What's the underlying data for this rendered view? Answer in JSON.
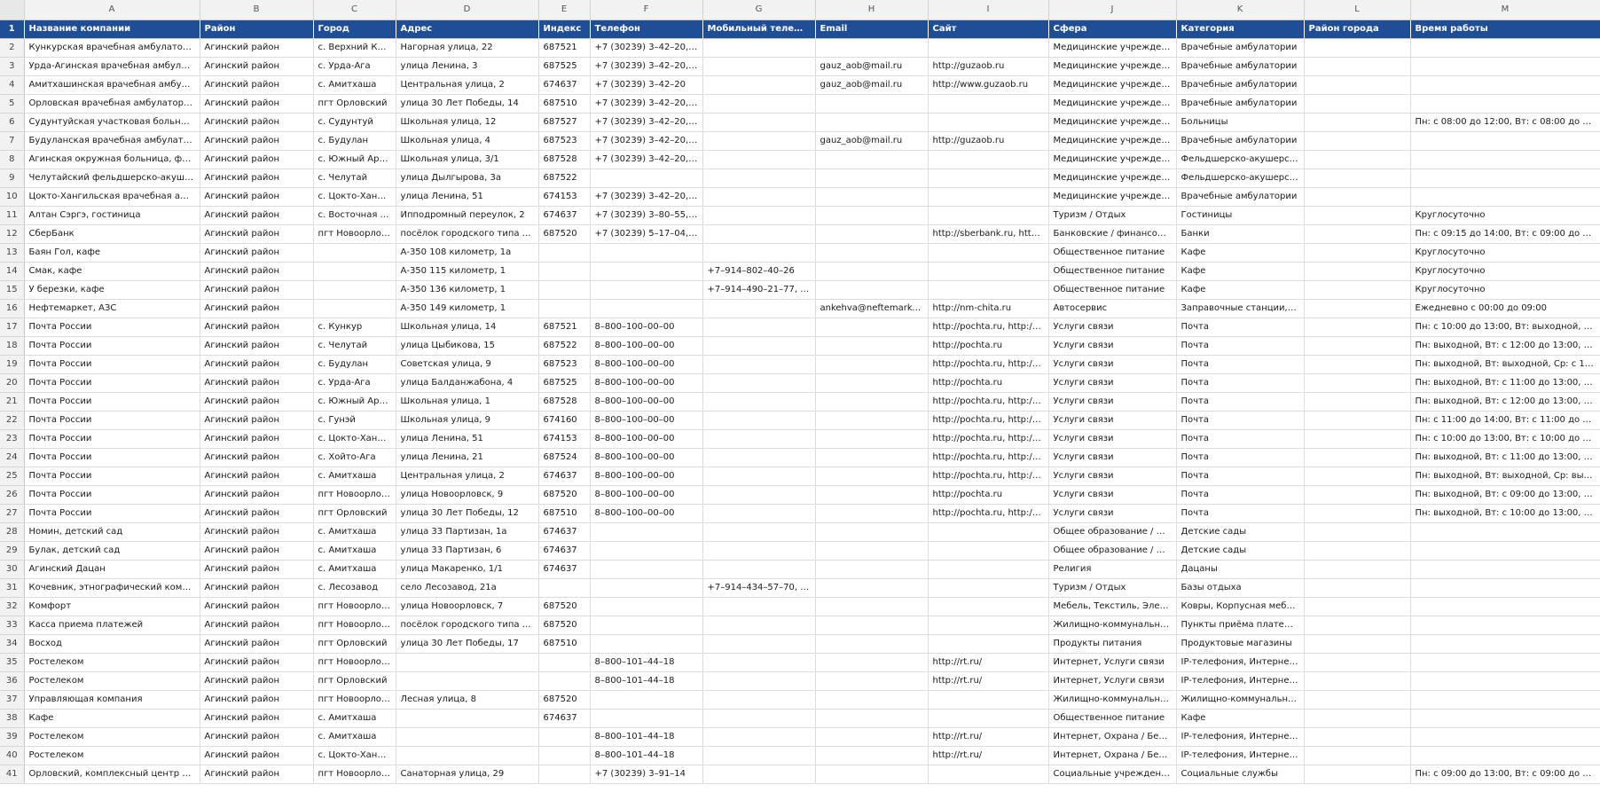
{
  "columns": [
    "A",
    "B",
    "C",
    "D",
    "E",
    "F",
    "G",
    "H",
    "I",
    "J",
    "K",
    "L",
    "M"
  ],
  "headers": [
    "Название компании",
    "Район",
    "Город",
    "Адрес",
    "Индекс",
    "Телефон",
    "Мобильный телефон",
    "Email",
    "Сайт",
    "Сфера",
    "Категория",
    "Район города",
    "Время работы"
  ],
  "header_row_number": "1",
  "rows": [
    {
      "n": "2",
      "c": [
        "Кункурская врачебная амбулатория",
        "Агинский район",
        "с. Верхний Кунк…",
        "Нагорная улица, 22",
        "687521",
        "+7 (30239) 3–42–20, +7…",
        "",
        "",
        "",
        "Медицинские учреждения",
        "Врачебные амбулатории",
        "",
        ""
      ]
    },
    {
      "n": "3",
      "c": [
        "Урда-Агинская врачебная амбулатория",
        "Агинский район",
        "с. Урда-Ага",
        "улица Ленина, 3",
        "687525",
        "+7 (30239) 3–42–20, +7…",
        "",
        "gauz_aob@mail.ru",
        "http://guzaob.ru",
        "Медицинские учреждения",
        "Врачебные амбулатории",
        "",
        ""
      ]
    },
    {
      "n": "4",
      "c": [
        "Амитхашинская врачебная амбулато…",
        "Агинский район",
        "с. Амитхаша",
        "Центральная улица, 2",
        "674637",
        "+7 (30239) 3–42–20",
        "",
        "gauz_aob@mail.ru",
        "http://www.guzaob.ru",
        "Медицинские учреждения",
        "Врачебные амбулатории",
        "",
        ""
      ]
    },
    {
      "n": "5",
      "c": [
        "Орловская врачебная амбулатория",
        "Агинский район",
        "пгт Орловский",
        "улица 30 Лет Победы, 14",
        "687510",
        "+7 (30239) 3–42–20, +7…",
        "",
        "",
        "",
        "Медицинские учреждения",
        "Врачебные амбулатории",
        "",
        ""
      ]
    },
    {
      "n": "6",
      "c": [
        "Судунтуйская участковая больница",
        "Агинский район",
        "с. Судунтуй",
        "Школьная улица, 12",
        "687527",
        "+7 (30239) 3–42–20, +7…",
        "",
        "",
        "",
        "Медицинские учреждения",
        "Больницы",
        "",
        "Пн: с 08:00 до 12:00, Вт: с 08:00 до 12:00, С…"
      ]
    },
    {
      "n": "7",
      "c": [
        "Будуланская врачебная амбулатория",
        "Агинский район",
        "с. Будулан",
        "Школьная улица, 4",
        "687523",
        "+7 (30239) 3–42–20, +7…",
        "",
        "gauz_aob@mail.ru",
        "http://guzaob.ru",
        "Медицинские учреждения",
        "Врачебные амбулатории",
        "",
        ""
      ]
    },
    {
      "n": "8",
      "c": [
        "Агинская окружная больница, фельд…",
        "Агинский район",
        "с. Южный Арга…",
        "Школьная улица, 3/1",
        "687528",
        "+7 (30239) 3–42–20, +7…",
        "",
        "",
        "",
        "Медицинские учреждения",
        "Фельдшерско-акушерские…",
        "",
        ""
      ]
    },
    {
      "n": "9",
      "c": [
        "Челутайский фельдшерско-акушерск…",
        "Агинский район",
        "с. Челутай",
        "улица Дылгырова, 3а",
        "687522",
        "",
        "",
        "",
        "",
        "Медицинские учреждения",
        "Фельдшерско-акушерские…",
        "",
        ""
      ]
    },
    {
      "n": "10",
      "c": [
        "Цокто-Хангильская врачебная амбул…",
        "Агинский район",
        "с. Цокто-Хангил",
        "улица Ленина, 51",
        "674153",
        "+7 (30239) 3–42–20, +7…",
        "",
        "",
        "",
        "Медицинские учреждения",
        "Врачебные амбулатории",
        "",
        ""
      ]
    },
    {
      "n": "11",
      "c": [
        "Алтан Сэргэ, гостиница",
        "Агинский район",
        "с. Восточная А…",
        "Ипподромный переулок, 2",
        "674637",
        "+7 (30239) 3–80–55, +7…",
        "",
        "",
        "",
        "Туризм / Отдых",
        "Гостиницы",
        "",
        "Круглосуточно"
      ]
    },
    {
      "n": "12",
      "c": [
        "СберБанк",
        "Агинский район",
        "пгт Новоорловск",
        "посёлок городского типа Нов…",
        "687520",
        "+7 (30239) 5–17–04, +7…",
        "",
        "",
        "http://sberbank.ru, http://…",
        "Банковские / финансовые…",
        "Банки",
        "",
        "Пн: с 09:15 до 14:00, Вт: с 09:00 до 14:00, С…"
      ]
    },
    {
      "n": "13",
      "c": [
        "Баян Гол, кафе",
        "Агинский район",
        "",
        "А-350 108 километр, 1а",
        "",
        "",
        "",
        "",
        "",
        "Общественное питание",
        "Кафе",
        "",
        "Круглосуточно"
      ]
    },
    {
      "n": "14",
      "c": [
        "Смак, кафе",
        "Агинский район",
        "",
        "А-350 115 километр, 1",
        "",
        "",
        "+7–914–802–40–26",
        "",
        "",
        "Общественное питание",
        "Кафе",
        "",
        "Круглосуточно"
      ]
    },
    {
      "n": "15",
      "c": [
        "У березки, кафе",
        "Агинский район",
        "",
        "А-350 136 километр, 1",
        "",
        "",
        "+7–914–490–21–77, +7…",
        "",
        "",
        "Общественное питание",
        "Кафе",
        "",
        "Круглосуточно"
      ]
    },
    {
      "n": "16",
      "c": [
        "Нефтемаркет, АЗС",
        "Агинский район",
        "",
        "А-350 149 километр, 1",
        "",
        "",
        "",
        "ankehva@neftemarket.c…",
        "http://nm-chita.ru",
        "Автосервис",
        "Заправочные станции, Он…",
        "",
        "Ежедневно с 00:00 до 09:00"
      ]
    },
    {
      "n": "17",
      "c": [
        "Почта России",
        "Агинский район",
        "с. Кункур",
        "Школьная улица, 14",
        "687521",
        "8–800–100–00–00",
        "",
        "",
        "http://pochta.ru, http://po…",
        "Услуги связи",
        "Почта",
        "",
        "Пн: с 10:00 до 13:00, Вт: выходной, Ср: с 1…"
      ]
    },
    {
      "n": "18",
      "c": [
        "Почта России",
        "Агинский район",
        "с. Челутай",
        "улица Цыбикова, 15",
        "687522",
        "8–800–100–00–00",
        "",
        "",
        "http://pochta.ru",
        "Услуги связи",
        "Почта",
        "",
        "Пн: выходной, Вт: с 12:00 до 13:00, Ср: вы…"
      ]
    },
    {
      "n": "19",
      "c": [
        "Почта России",
        "Агинский район",
        "с. Будулан",
        "Советская улица, 9",
        "687523",
        "8–800–100–00–00",
        "",
        "",
        "http://pochta.ru, http://po…",
        "Услуги связи",
        "Почта",
        "",
        "Пн: выходной, Вт: выходной, Ср: с 10:00 д…"
      ]
    },
    {
      "n": "20",
      "c": [
        "Почта России",
        "Агинский район",
        "с. Урда-Ага",
        "улица Балданжабона, 4",
        "687525",
        "8–800–100–00–00",
        "",
        "",
        "http://pochta.ru",
        "Услуги связи",
        "Почта",
        "",
        "Пн: выходной, Вт: с 11:00 до 13:00, Ср: вы…"
      ]
    },
    {
      "n": "21",
      "c": [
        "Почта России",
        "Агинский район",
        "с. Южный Арга…",
        "Школьная улица, 1",
        "687528",
        "8–800–100–00–00",
        "",
        "",
        "http://pochta.ru, http://po…",
        "Услуги связи",
        "Почта",
        "",
        "Пн: выходной, Вт: с 12:00 до 13:00, Ср: вы…"
      ]
    },
    {
      "n": "22",
      "c": [
        "Почта России",
        "Агинский район",
        "с. Гунэй",
        "Школьная улица, 9",
        "674160",
        "8–800–100–00–00",
        "",
        "",
        "http://pochta.ru, http://po…",
        "Услуги связи",
        "Почта",
        "",
        "Пн: с 11:00 до 14:00, Вт: с 11:00 до 14:00, С…"
      ]
    },
    {
      "n": "23",
      "c": [
        "Почта России",
        "Агинский район",
        "с. Цокто-Хангил",
        "улица Ленина, 51",
        "674153",
        "8–800–100–00–00",
        "",
        "",
        "http://pochta.ru, http://po…",
        "Услуги связи",
        "Почта",
        "",
        "Пн: с 10:00 до 13:00, Вт: с 10:00 до 13:00, С…"
      ]
    },
    {
      "n": "24",
      "c": [
        "Почта России",
        "Агинский район",
        "с. Хойто-Ага",
        "улица Ленина, 21",
        "687524",
        "8–800–100–00–00",
        "",
        "",
        "http://pochta.ru, http://po…",
        "Услуги связи",
        "Почта",
        "",
        "Пн: выходной, Вт: с 11:00 до 13:00, Ср: вы…"
      ]
    },
    {
      "n": "25",
      "c": [
        "Почта России",
        "Агинский район",
        "с. Амитхаша",
        "Центральная улица, 2",
        "674637",
        "8–800–100–00–00",
        "",
        "",
        "http://pochta.ru, http://po…",
        "Услуги связи",
        "Почта",
        "",
        "Пн: выходной, Вт: выходной, Ср: выходно…"
      ]
    },
    {
      "n": "26",
      "c": [
        "Почта России",
        "Агинский район",
        "пгт Новоорловск",
        "улица Новоорловск, 9",
        "687520",
        "8–800–100–00–00",
        "",
        "",
        "http://pochta.ru",
        "Услуги связи",
        "Почта",
        "",
        "Пн: выходной, Вт: с 09:00 до 13:00, Ср: с 0…"
      ]
    },
    {
      "n": "27",
      "c": [
        "Почта России",
        "Агинский район",
        "пгт Орловский",
        "улица 30 Лет Победы, 12",
        "687510",
        "8–800–100–00–00",
        "",
        "",
        "http://pochta.ru, http://po…",
        "Услуги связи",
        "Почта",
        "",
        "Пн: выходной, Вт: с 10:00 до 13:00, Ср: с 1…"
      ]
    },
    {
      "n": "28",
      "c": [
        "Номин, детский сад",
        "Агинский район",
        "с. Амитхаша",
        "улица 33 Партизан, 1а",
        "674637",
        "",
        "",
        "",
        "",
        "Общее образование / Цен…",
        "Детские сады",
        "",
        ""
      ]
    },
    {
      "n": "29",
      "c": [
        "Булак, детский сад",
        "Агинский район",
        "с. Амитхаша",
        "улица 33 Партизан, 6",
        "674637",
        "",
        "",
        "",
        "",
        "Общее образование / Цен…",
        "Детские сады",
        "",
        ""
      ]
    },
    {
      "n": "30",
      "c": [
        "Агинский Дацан",
        "Агинский район",
        "с. Амитхаша",
        "улица Макаренко, 1/1",
        "674637",
        "",
        "",
        "",
        "",
        "Религия",
        "Дацаны",
        "",
        ""
      ]
    },
    {
      "n": "31",
      "c": [
        "Кочевник, этнографический комплекс",
        "Агинский район",
        "с. Лесозавод",
        "село Лесозавод, 21а",
        "",
        "",
        "+7–914–434–57–70, +7…",
        "",
        "",
        "Туризм / Отдых",
        "Базы отдыха",
        "",
        ""
      ]
    },
    {
      "n": "32",
      "c": [
        "Комфорт",
        "Агинский район",
        "пгт Новоорловск",
        "улица Новоорловск, 7",
        "687520",
        "",
        "",
        "",
        "",
        "Мебель, Текстиль, Электро…",
        "Ковры, Корпусная мебель,…",
        "",
        ""
      ]
    },
    {
      "n": "33",
      "c": [
        "Касса приема платежей",
        "Агинский район",
        "пгт Новоорловск",
        "посёлок городского типа Нов…",
        "687520",
        "",
        "",
        "",
        "",
        "Жилищно-коммунальные …",
        "Пункты приёма платежей …",
        "",
        ""
      ]
    },
    {
      "n": "34",
      "c": [
        "Восход",
        "Агинский район",
        "пгт Орловский",
        "улица 30 Лет Победы, 17",
        "687510",
        "",
        "",
        "",
        "",
        "Продукты питания",
        "Продуктовые магазины",
        "",
        ""
      ]
    },
    {
      "n": "35",
      "c": [
        "Ростелеком",
        "Агинский район",
        "пгт Новоорловск",
        "",
        "",
        "8–800–101–44–18",
        "",
        "",
        "http://rt.ru/",
        "Интернет, Услуги связи",
        "IP-телефония, Интернет-п…",
        "",
        ""
      ]
    },
    {
      "n": "36",
      "c": [
        "Ростелеком",
        "Агинский район",
        "пгт Орловский",
        "",
        "",
        "8–800–101–44–18",
        "",
        "",
        "http://rt.ru/",
        "Интернет, Услуги связи",
        "IP-телефония, Интернет-п…",
        "",
        ""
      ]
    },
    {
      "n": "37",
      "c": [
        "Управляющая компания",
        "Агинский район",
        "пгт Новоорловск",
        "Лесная улица, 8",
        "687520",
        "",
        "",
        "",
        "",
        "Жилищно-коммунальные …",
        "Жилищно-коммунальные …",
        "",
        ""
      ]
    },
    {
      "n": "38",
      "c": [
        "Кафе",
        "Агинский район",
        "с. Амитхаша",
        "",
        "674637",
        "",
        "",
        "",
        "",
        "Общественное питание",
        "Кафе",
        "",
        ""
      ]
    },
    {
      "n": "39",
      "c": [
        "Ростелеком",
        "Агинский район",
        "с. Амитхаша",
        "",
        "",
        "8–800–101–44–18",
        "",
        "",
        "http://rt.ru/",
        "Интернет, Охрана / Безоп…",
        "IP-телефония, Интернет-п…",
        "",
        ""
      ]
    },
    {
      "n": "40",
      "c": [
        "Ростелеком",
        "Агинский район",
        "с. Цокто-Хангил",
        "",
        "",
        "8–800–101–44–18",
        "",
        "",
        "http://rt.ru/",
        "Интернет, Охрана / Безоп…",
        "IP-телефония, Интернет-п…",
        "",
        ""
      ]
    },
    {
      "n": "41",
      "c": [
        "Орловский, комплексный центр соци…",
        "Агинский район",
        "пгт Новоорловск",
        "Санаторная улица, 29",
        "",
        "+7 (30239) 3–91–14",
        "",
        "",
        "",
        "Социальные учреждения",
        "Социальные службы",
        "",
        "Пн: с 09:00 до 13:00, Вт: с 09:00 до 13:00, С…"
      ]
    }
  ]
}
